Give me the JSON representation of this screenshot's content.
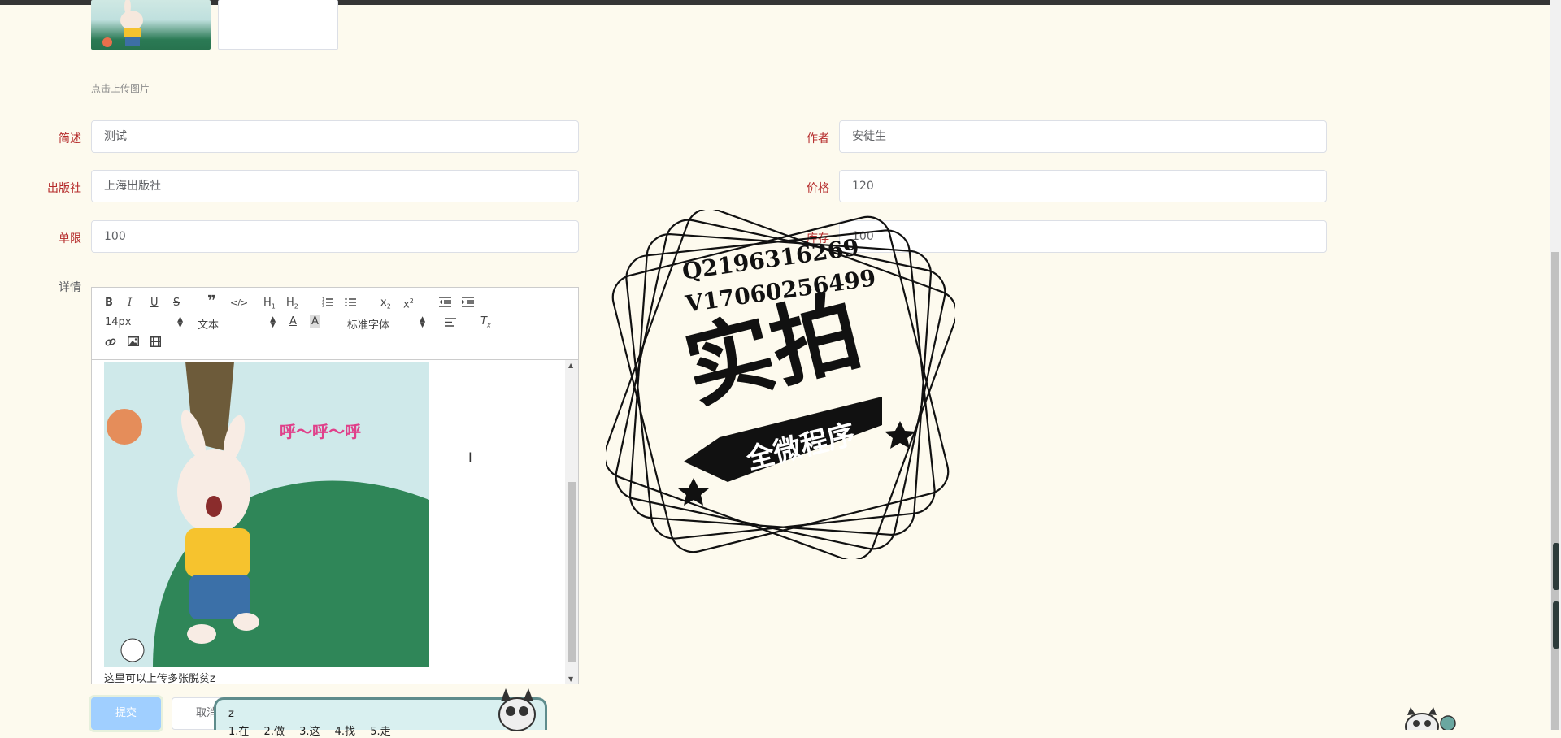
{
  "upload": {
    "hint": "点击上传图片"
  },
  "form": {
    "summary": {
      "label": "简述",
      "value": "测试"
    },
    "author": {
      "label": "作者",
      "value": "安徒生"
    },
    "publisher": {
      "label": "出版社",
      "value": "上海出版社"
    },
    "price": {
      "label": "价格",
      "value": "120"
    },
    "limit": {
      "label": "单限",
      "value": "100"
    },
    "stock": {
      "label": "库存",
      "value": "100"
    },
    "detail": {
      "label": "详情"
    }
  },
  "editor": {
    "font_size": "14px",
    "header": "文本",
    "font_family": "标准字体",
    "image_caption": "呼～呼～呼",
    "text": "这里可以上传多张脱贫z"
  },
  "buttons": {
    "submit": "提交",
    "cancel": "取消"
  },
  "ime": {
    "input": "z",
    "candidates": [
      "1.在",
      "2.做",
      "3.这",
      "4.找",
      "5.走"
    ]
  },
  "watermark": {
    "line1": "Q2196316269",
    "line2": "V17060256499",
    "main": "实拍",
    "ribbon": "全微程序"
  },
  "colors": {
    "label_red": "#b52b2b",
    "submit_disabled": "#a0cfff",
    "page_bg": "#fdfaee"
  }
}
